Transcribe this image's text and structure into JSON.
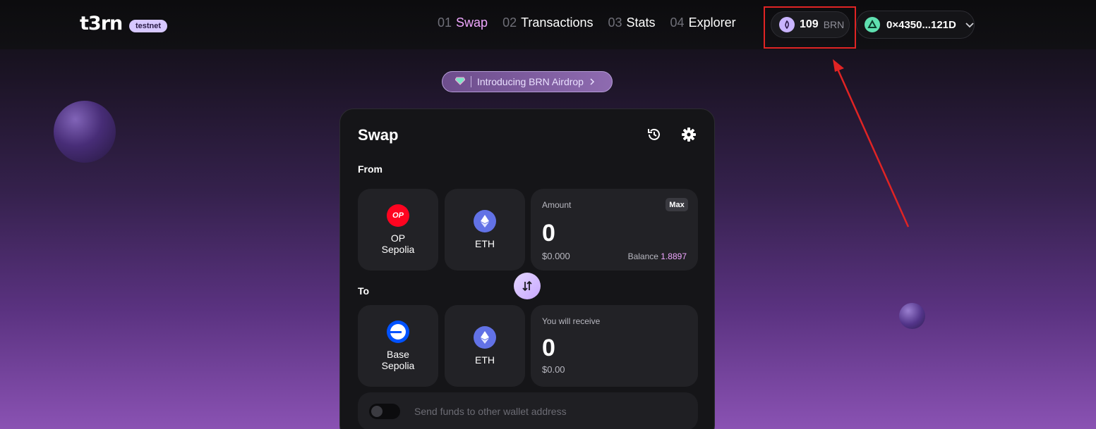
{
  "header": {
    "logo_text": "t3rn",
    "network_badge": "testnet",
    "nav": [
      {
        "num": "01",
        "label": "Swap",
        "active": true
      },
      {
        "num": "02",
        "label": "Transactions",
        "active": false
      },
      {
        "num": "03",
        "label": "Stats",
        "active": false
      },
      {
        "num": "04",
        "label": "Explorer",
        "active": false
      }
    ],
    "brn_amount": "109",
    "brn_unit": "BRN",
    "wallet_address": "0×4350...121D"
  },
  "airdrop_banner": {
    "label": "Introducing BRN Airdrop"
  },
  "swap": {
    "title": "Swap",
    "from_label": "From",
    "to_label": "To",
    "from_network": "OP Sepolia",
    "from_network_icon_text": "OP",
    "from_token": "ETH",
    "amount_label": "Amount",
    "max_label": "Max",
    "amount_value": "0",
    "amount_usd": "$0.000",
    "balance_label": "Balance",
    "balance_value": "1.8897",
    "to_network": "Base Sepolia",
    "to_token": "ETH",
    "receive_label": "You will receive",
    "receive_value": "0",
    "receive_usd": "$0.00",
    "send_other_label": "Send funds to other wallet address"
  },
  "colors": {
    "accent": "#f0a7ff",
    "highlight": "#e02424",
    "op_red": "#ff0420",
    "eth_blue": "#6272e6",
    "base_blue": "#0052ff"
  }
}
